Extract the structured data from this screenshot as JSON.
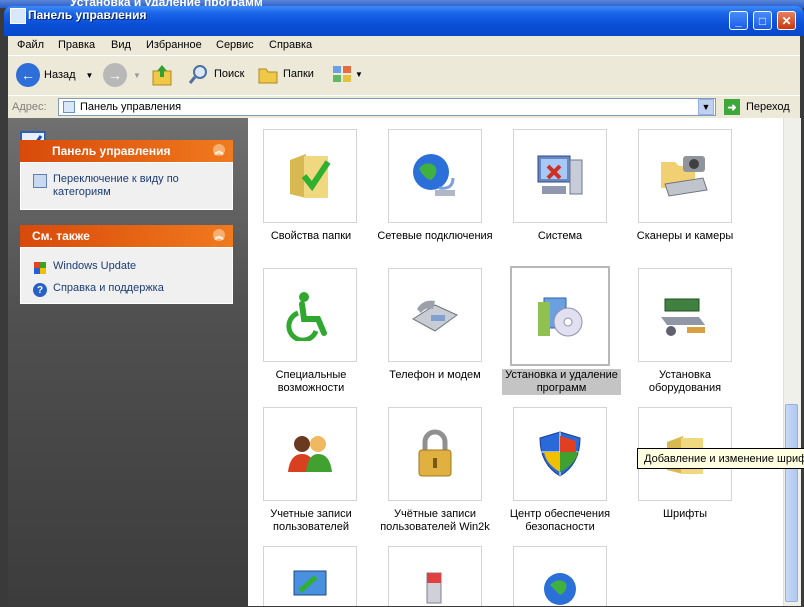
{
  "background_window": {
    "title": "Установка и удаление программ"
  },
  "window": {
    "title": "Панель управления"
  },
  "menu": [
    "Файл",
    "Правка",
    "Вид",
    "Избранное",
    "Сервис",
    "Справка"
  ],
  "toolbar": {
    "back_label": "Назад",
    "search_label": "Поиск",
    "folders_label": "Папки"
  },
  "address": {
    "label": "Адрес:",
    "value": "Панель управления",
    "go_label": "Переход"
  },
  "left_panels": [
    {
      "title": "Панель управления",
      "tasks": [
        "Переключение к виду по категориям"
      ]
    },
    {
      "title": "См. также",
      "tasks": [
        "Windows Update",
        "Справка и поддержка"
      ]
    }
  ],
  "items": [
    "Свойства папки",
    "Сетевые подключения",
    "Система",
    "Сканеры и камеры",
    "Специальные возможности",
    "Телефон и модем",
    "Установка и удаление программ",
    "Установка оборудования",
    "Учетные записи пользователей",
    "Учётные записи пользователей Win2k",
    "Центр обеспечения безопасности",
    "Шрифты"
  ],
  "selected_item": "Установка и удаление программ",
  "tooltip": "Добавление и изменение шрифтов",
  "colors": {
    "titlebar": "#0a50d8",
    "panel_header": "#e8601a",
    "selection": "#c4c4c4"
  }
}
